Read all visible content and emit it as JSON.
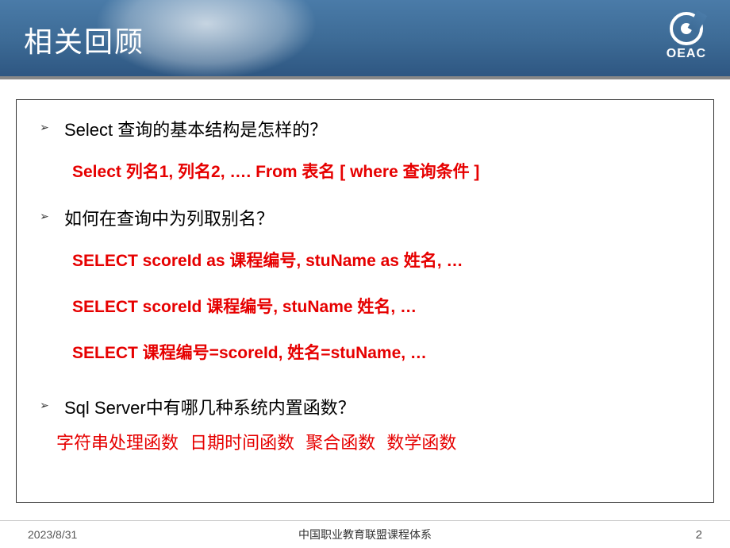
{
  "header": {
    "title": "相关回顾",
    "logo_text": "OEAC"
  },
  "content": {
    "q1": "Select 查询的基本结构是怎样的？",
    "a1": "Select 列名1, 列名2, …. From 表名 [ where 查询条件 ]",
    "q2": "如何在查询中为列取别名？",
    "a2_1": "SELECT scoreId as  课程编号, stuName as  姓名, …",
    "a2_2": "SELECT scoreId 课程编号, stuName 姓名, …",
    "a2_3": "SELECT 课程编号=scoreId, 姓名=stuName, …",
    "q3": "Sql Server中有哪几种系统内置函数？",
    "a3": "字符串处理函数  日期时间函数  聚合函数  数学函数"
  },
  "footer": {
    "date": "2023/8/31",
    "center": "中国职业教育联盟课程体系",
    "page": "2"
  },
  "bullet_glyph": "➢"
}
